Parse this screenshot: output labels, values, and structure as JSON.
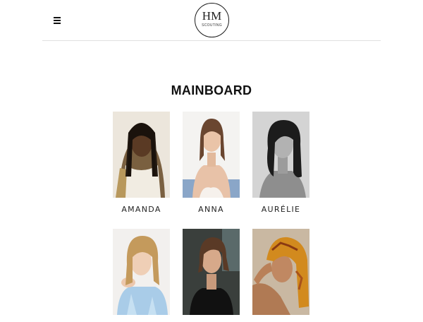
{
  "header": {
    "logo_mark": "HM",
    "logo_sub": "SCOUTING"
  },
  "page": {
    "title": "MAINBOARD"
  },
  "models": [
    {
      "name": "AMANDA"
    },
    {
      "name": "ANNA"
    },
    {
      "name": "AURÉLIE"
    },
    {
      "name": ""
    },
    {
      "name": ""
    },
    {
      "name": ""
    }
  ],
  "colors": {
    "text": "#111111",
    "divider": "#e1e1e1",
    "background": "#ffffff"
  }
}
